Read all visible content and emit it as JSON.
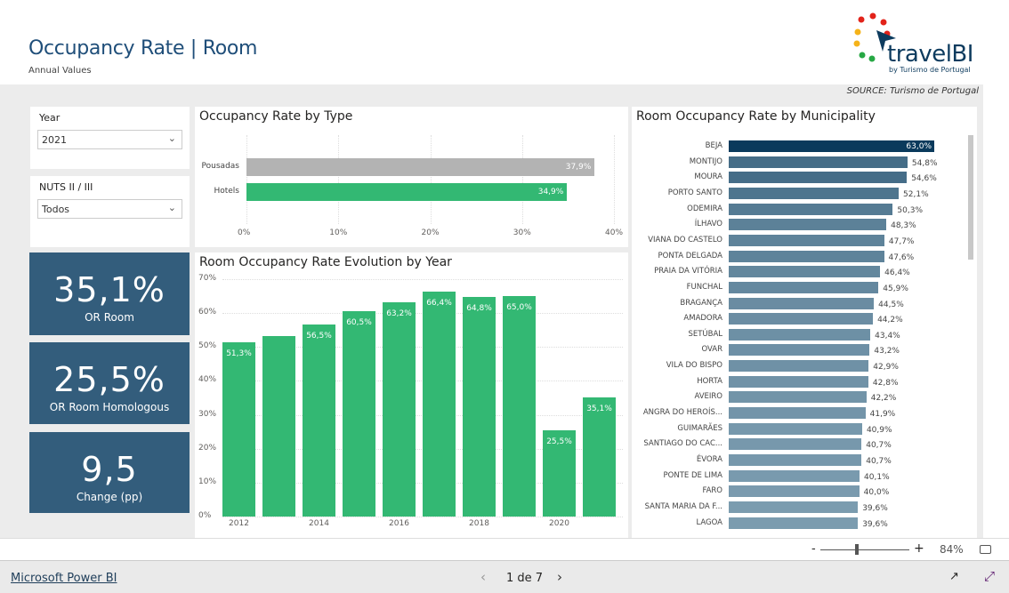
{
  "header": {
    "title": "Occupancy Rate | Room",
    "subtitle": "Annual Values",
    "logo_text": "travelBI",
    "logo_sub": "by Turismo de Portugal",
    "source_label": "SOURCE:",
    "source_value": "Turismo de Portugal"
  },
  "slicers": [
    {
      "label": "Year",
      "value": "2021"
    },
    {
      "label": "NUTS II / III",
      "value": "Todos"
    }
  ],
  "kpis": [
    {
      "value": "35,1%",
      "label": "OR Room"
    },
    {
      "value": "25,5%",
      "label": "OR Room Homologous"
    },
    {
      "value": "9,5",
      "label": "Change (pp)"
    }
  ],
  "colors": {
    "kpi_bg": "#335d7c",
    "green": "#33b873",
    "gray_bar": "#b3b3b3",
    "municipality_top": "#0a3a5c",
    "municipality_low": "#7f9fb2"
  },
  "chart_data": [
    {
      "type": "bar",
      "orientation": "horizontal",
      "title": "Occupancy Rate by Type",
      "categories": [
        "Pousadas",
        "Hotels"
      ],
      "values": [
        37.9,
        34.9
      ],
      "labels": [
        "37,9%",
        "34,9%"
      ],
      "xlim": [
        0,
        40
      ],
      "xticks": [
        "0%",
        "10%",
        "20%",
        "30%",
        "40%"
      ],
      "colors": [
        "#b3b3b3",
        "#33b873"
      ],
      "grid": true
    },
    {
      "type": "bar",
      "title": "Room Occupancy Rate Evolution by Year",
      "categories": [
        "2012",
        "2013",
        "2014",
        "2015",
        "2016",
        "2017",
        "2018",
        "2019",
        "2020",
        "2021"
      ],
      "values": [
        51.3,
        53.3,
        56.5,
        60.5,
        63.2,
        66.4,
        64.8,
        65.0,
        25.5,
        35.1
      ],
      "labels": [
        "51,3%",
        "",
        "56,5%",
        "60,5%",
        "63,2%",
        "66,4%",
        "64,8%",
        "65,0%",
        "25,5%",
        "35,1%"
      ],
      "xtick_labels": [
        "2012",
        "",
        "2014",
        "",
        "2016",
        "",
        "2018",
        "",
        "2020",
        ""
      ],
      "ylim": [
        0,
        70
      ],
      "yticks": [
        "0%",
        "10%",
        "20%",
        "30%",
        "40%",
        "50%",
        "60%",
        "70%"
      ],
      "grid": true
    },
    {
      "type": "bar",
      "orientation": "horizontal",
      "title": "Room Occupancy Rate by Municipality",
      "categories": [
        "BEJA",
        "MONTIJO",
        "MOURA",
        "PORTO SANTO",
        "ODEMIRA",
        "ÍLHAVO",
        "VIANA DO CASTELO",
        "PONTA DELGADA",
        "PRAIA DA VITÓRIA",
        "FUNCHAL",
        "BRAGANÇA",
        "AMADORA",
        "SETÚBAL",
        "OVAR",
        "VILA DO BISPO",
        "HORTA",
        "AVEIRO",
        "ANGRA DO HEROÍS...",
        "GUIMARÃES",
        "SANTIAGO DO CAC...",
        "ÉVORA",
        "PONTE DE LIMA",
        "FARO",
        "SANTA MARIA DA F...",
        "LAGOA"
      ],
      "values": [
        63.0,
        54.8,
        54.6,
        52.1,
        50.3,
        48.3,
        47.7,
        47.6,
        46.4,
        45.9,
        44.5,
        44.2,
        43.4,
        43.2,
        42.9,
        42.8,
        42.2,
        41.9,
        40.9,
        40.7,
        40.7,
        40.1,
        40.0,
        39.6,
        39.6
      ],
      "labels": [
        "63,0%",
        "54,8%",
        "54,6%",
        "52,1%",
        "50,3%",
        "48,3%",
        "47,7%",
        "47,6%",
        "46,4%",
        "45,9%",
        "44,5%",
        "44,2%",
        "43,4%",
        "43,2%",
        "42,9%",
        "42,8%",
        "42,2%",
        "41,9%",
        "40,9%",
        "40,7%",
        "40,7%",
        "40,1%",
        "40,0%",
        "39,6%",
        "39,6%"
      ]
    }
  ],
  "status": {
    "zoom_minus": "-",
    "zoom_plus": "+",
    "zoom": "84%"
  },
  "footer": {
    "brand": "Microsoft Power BI",
    "page": "1 de 7"
  }
}
